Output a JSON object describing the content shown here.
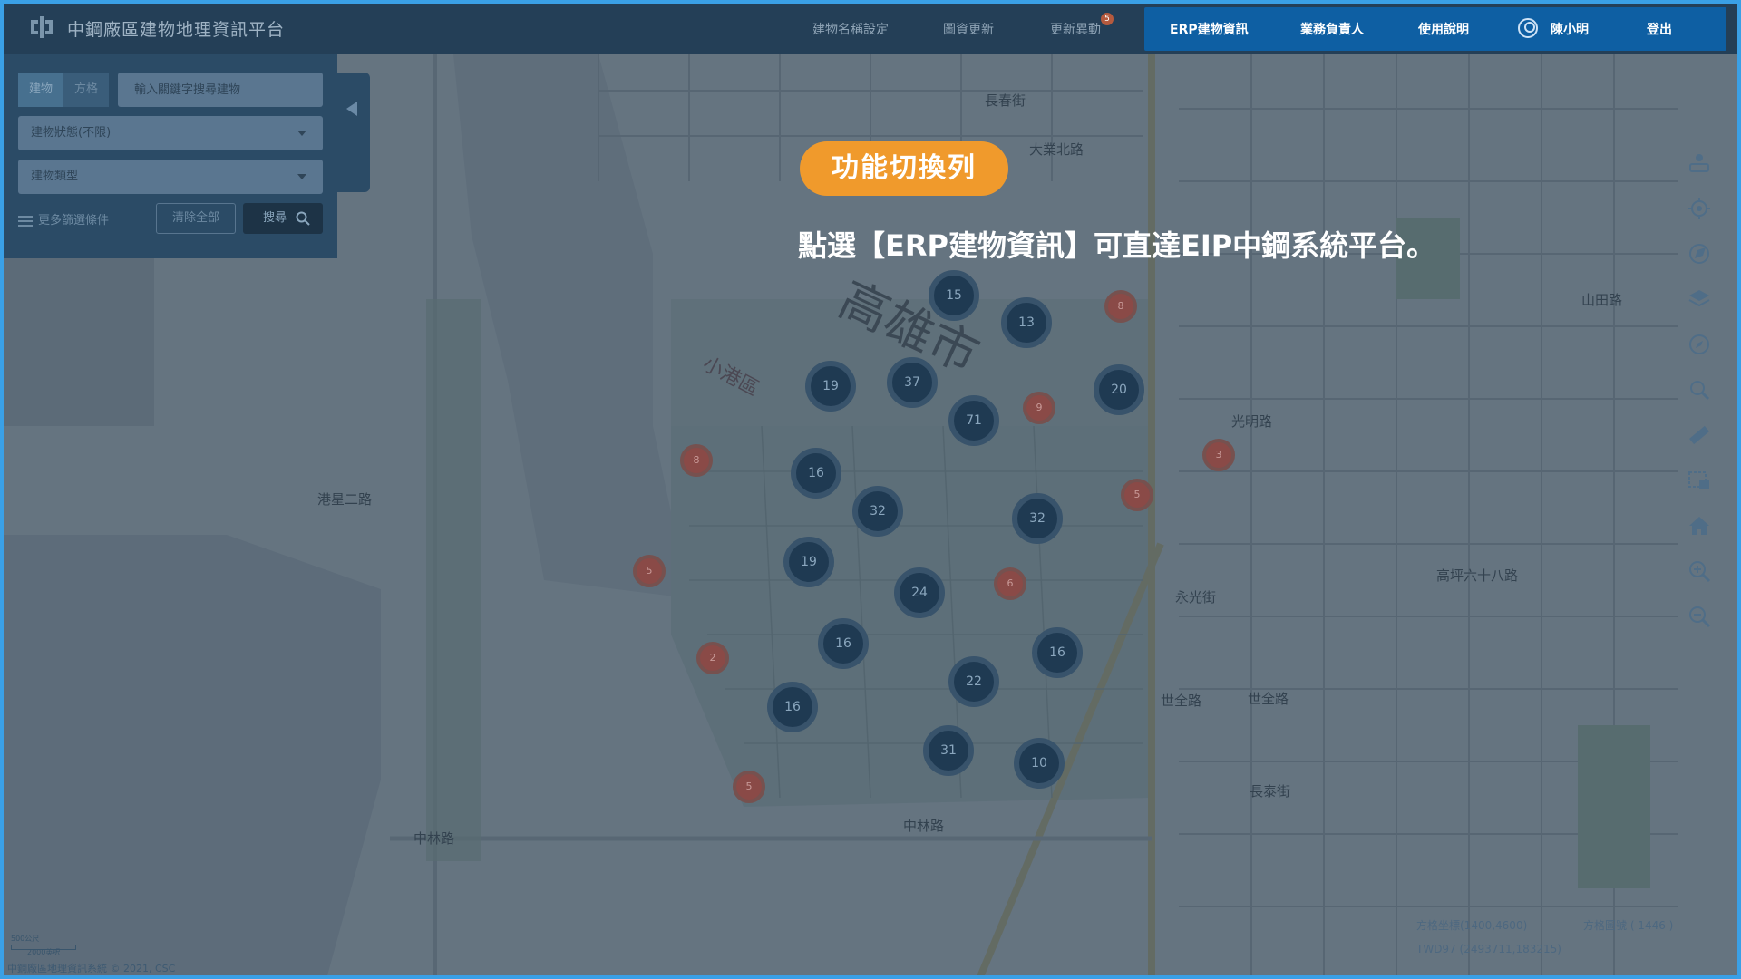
{
  "app": {
    "title": "中鋼廠區建物地理資訊平台"
  },
  "header": {
    "nav_dim": [
      "建物名稱設定",
      "圖資更新",
      "更新異動"
    ],
    "badge": "5",
    "nav_highlight": [
      "ERP建物資訊",
      "業務負責人",
      "使用說明"
    ],
    "user_name": "陳小明",
    "logout": "登出"
  },
  "search_panel": {
    "tab_building": "建物",
    "tab_grid": "方格",
    "search_placeholder": "輸入關鍵字搜尋建物",
    "status_select": "建物狀態(不限)",
    "type_select": "建物類型",
    "more_filters": "更多篩選條件",
    "clear_all": "清除全部",
    "search": "搜尋"
  },
  "tutorial": {
    "title": "功能切換列",
    "text": "點選【ERP建物資訊】可直達EIP中鋼系統平台。"
  },
  "map": {
    "district_label": "高雄市",
    "sub_label": "小港區",
    "clusters": [
      {
        "count": "15",
        "kind": "blue"
      },
      {
        "count": "13",
        "kind": "blue"
      },
      {
        "count": "8",
        "kind": "red"
      },
      {
        "count": "19",
        "kind": "blue"
      },
      {
        "count": "37",
        "kind": "blue"
      },
      {
        "count": "71",
        "kind": "blue"
      },
      {
        "count": "9",
        "kind": "red"
      },
      {
        "count": "20",
        "kind": "blue"
      },
      {
        "count": "3",
        "kind": "red"
      },
      {
        "count": "8",
        "kind": "red"
      },
      {
        "count": "16",
        "kind": "blue"
      },
      {
        "count": "32",
        "kind": "blue"
      },
      {
        "count": "32",
        "kind": "blue"
      },
      {
        "count": "5",
        "kind": "red"
      },
      {
        "count": "19",
        "kind": "blue"
      },
      {
        "count": "24",
        "kind": "blue"
      },
      {
        "count": "6",
        "kind": "red"
      },
      {
        "count": "5",
        "kind": "red"
      },
      {
        "count": "16",
        "kind": "blue"
      },
      {
        "count": "16",
        "kind": "blue"
      },
      {
        "count": "2",
        "kind": "red"
      },
      {
        "count": "16",
        "kind": "blue"
      },
      {
        "count": "22",
        "kind": "blue"
      },
      {
        "count": "31",
        "kind": "blue"
      },
      {
        "count": "10",
        "kind": "blue"
      },
      {
        "count": "5",
        "kind": "red"
      }
    ],
    "road_labels": [
      "長春街",
      "大業北路",
      "光明路",
      "港星二路",
      "中林路",
      "中林路",
      "世全路",
      "世全路",
      "永光街",
      "高坪六十八路",
      "山田路",
      "長泰街"
    ]
  },
  "toolbar": [
    "street-view-icon",
    "locate-icon",
    "navigation-icon",
    "layers-icon",
    "compass-icon",
    "search-zoom-icon",
    "ruler-icon",
    "screenshot-icon",
    "home-icon",
    "zoom-in-icon",
    "zoom-out-icon"
  ],
  "footer": {
    "grid_coord": "方格坐標(1400,4600)",
    "grid_no": "方格圖號 ( 1446 )",
    "twd": "TWD97 (2493711,183215)",
    "scale_top": "500公尺",
    "scale_bottom": "2000英呎",
    "copyright": "中鋼廠區地理資訊系統 © 2021, CSC"
  },
  "colors": {
    "accent_orange": "#f09a2c",
    "nav_highlight": "#0e5fa3",
    "frame": "#3aa0e6"
  }
}
